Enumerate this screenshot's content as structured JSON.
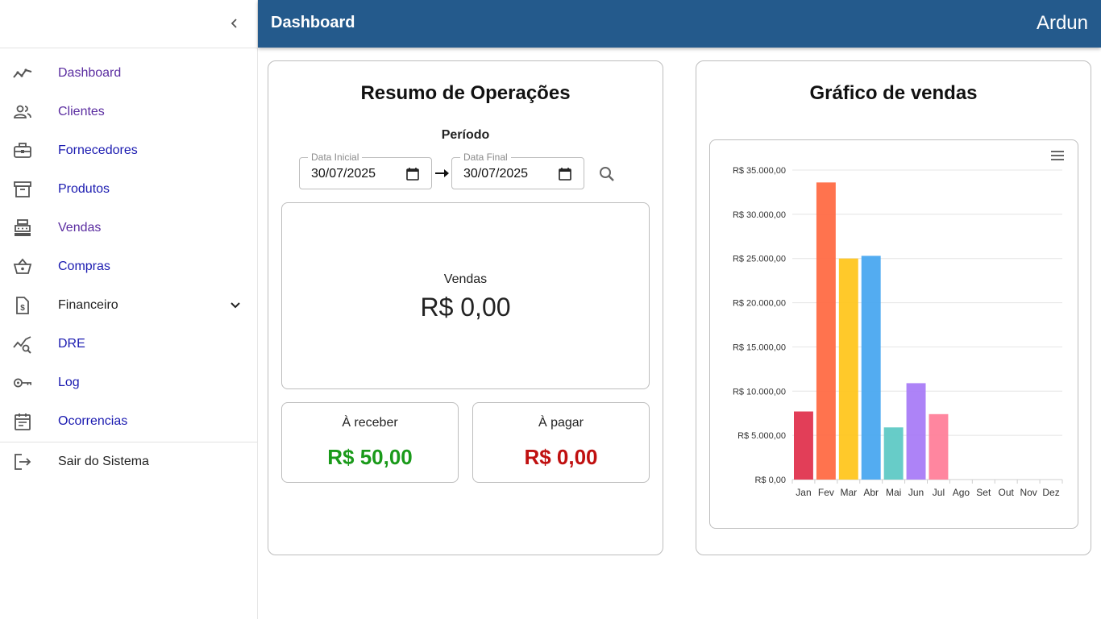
{
  "sidebar": {
    "collapse_icon": "chevron-left-icon",
    "items": [
      {
        "label": "Dashboard",
        "icon": "trend-line-icon"
      },
      {
        "label": "Clientes",
        "icon": "people-icon"
      },
      {
        "label": "Fornecedores",
        "icon": "briefcase-icon"
      },
      {
        "label": "Produtos",
        "icon": "archive-box-icon"
      },
      {
        "label": "Vendas",
        "icon": "cash-register-icon"
      },
      {
        "label": "Compras",
        "icon": "basket-icon"
      },
      {
        "label": "Financeiro",
        "icon": "invoice-dollar-icon"
      },
      {
        "label": "DRE",
        "icon": "chart-search-icon"
      },
      {
        "label": "Log",
        "icon": "key-icon"
      },
      {
        "label": "Ocorrencias",
        "icon": "calendar-icon"
      }
    ],
    "logout": {
      "label": "Sair do Sistema",
      "icon": "logout-icon"
    }
  },
  "header": {
    "title": "Dashboard",
    "user": "Ardun",
    "bg_color": "#245a8c"
  },
  "summary": {
    "title": "Resumo de Operações",
    "period_label": "Período",
    "start_date": {
      "legend": "Data Inicial",
      "value": "30/07/2025"
    },
    "end_date": {
      "legend": "Data Final",
      "value": "30/07/2025"
    },
    "sales": {
      "label": "Vendas",
      "value": "R$ 0,00"
    },
    "receivable": {
      "label": "À receber",
      "value": "R$ 50,00",
      "color": "#1a9a1a"
    },
    "payable": {
      "label": "À pagar",
      "value": "R$ 0,00",
      "color": "#c01010"
    }
  },
  "chart_card": {
    "title": "Gráfico de vendas"
  },
  "chart_data": {
    "type": "bar",
    "categories": [
      "Jan",
      "Fev",
      "Mar",
      "Abr",
      "Mai",
      "Jun",
      "Jul",
      "Ago",
      "Set",
      "Out",
      "Nov",
      "Dez"
    ],
    "values": [
      7700,
      33600,
      25000,
      25300,
      5900,
      10900,
      7400,
      0,
      0,
      0,
      0,
      0
    ],
    "colors": [
      "#e0344f",
      "#ff6b45",
      "#ffc61f",
      "#4aa8f0",
      "#5fc9c5",
      "#a97cf7",
      "#ff7f9a",
      "#cccccc",
      "#cccccc",
      "#cccccc",
      "#cccccc",
      "#cccccc"
    ],
    "ylim": [
      0,
      35000
    ],
    "yticks": [
      0,
      5000,
      10000,
      15000,
      20000,
      25000,
      30000,
      35000
    ],
    "ytick_labels": [
      "R$ 0,00",
      "R$ 5.000,00",
      "R$ 10.000,00",
      "R$ 15.000,00",
      "R$ 20.000,00",
      "R$ 25.000,00",
      "R$ 30.000,00",
      "R$ 35.000,00"
    ],
    "grid": true,
    "title": "",
    "xlabel": "",
    "ylabel": ""
  }
}
